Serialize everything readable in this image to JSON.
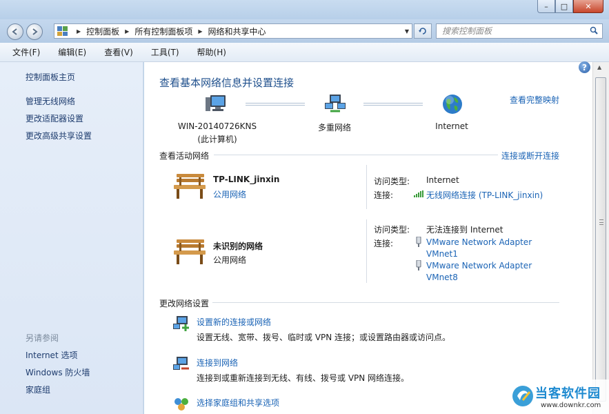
{
  "window": {
    "min_symbol": "–",
    "max_symbol": "□",
    "close_symbol": "✕"
  },
  "addressbar": {
    "breadcrumb": [
      "控制面板",
      "所有控制面板项",
      "网络和共享中心"
    ],
    "search_placeholder": "搜索控制面板"
  },
  "menu": [
    "文件(F)",
    "编辑(E)",
    "查看(V)",
    "工具(T)",
    "帮助(H)"
  ],
  "sidebar": {
    "home": "控制面板主页",
    "tasks": [
      "管理无线网络",
      "更改适配器设置",
      "更改高级共享设置"
    ],
    "see_also_heading": "另请参阅",
    "see_also": [
      "Internet 选项",
      "Windows 防火墙",
      "家庭组"
    ]
  },
  "main": {
    "title": "查看基本网络信息并设置连接",
    "view_full_map": "查看完整映射",
    "map": {
      "computer_name": "WIN-20140726KNS",
      "computer_sub": "(此计算机)",
      "middle": "多重网络",
      "internet": "Internet"
    },
    "active_heading": "查看活动网络",
    "connect_disconnect": "连接或断开连接",
    "networks": [
      {
        "name": "TP-LINK_jinxin",
        "type": "公用网络",
        "access_label": "访问类型:",
        "access_value": "Internet",
        "conn_label": "连接:",
        "conn_links": [
          "无线网络连接 (TP-LINK_jinxin)"
        ]
      },
      {
        "name": "未识别的网络",
        "type": "公用网络",
        "access_label": "访问类型:",
        "access_value": "无法连接到 Internet",
        "conn_label": "连接:",
        "conn_links": [
          "VMware Network Adapter",
          "VMnet1",
          "VMware Network Adapter",
          "VMnet8"
        ]
      }
    ],
    "change_heading": "更改网络设置",
    "tasks": [
      {
        "link": "设置新的连接或网络",
        "desc": "设置无线、宽带、拨号、临时或 VPN 连接；或设置路由器或访问点。"
      },
      {
        "link": "连接到网络",
        "desc": "连接到或重新连接到无线、有线、拨号或 VPN 网络连接。"
      },
      {
        "link": "选择家庭组和共享选项",
        "desc": ""
      }
    ]
  },
  "watermark": {
    "brand": "当客软件园",
    "url": "www.downkr.com"
  },
  "colors": {
    "link": "#1a63b5",
    "title": "#1e4f8c",
    "sidebar_bg": "#dbe6f5"
  }
}
